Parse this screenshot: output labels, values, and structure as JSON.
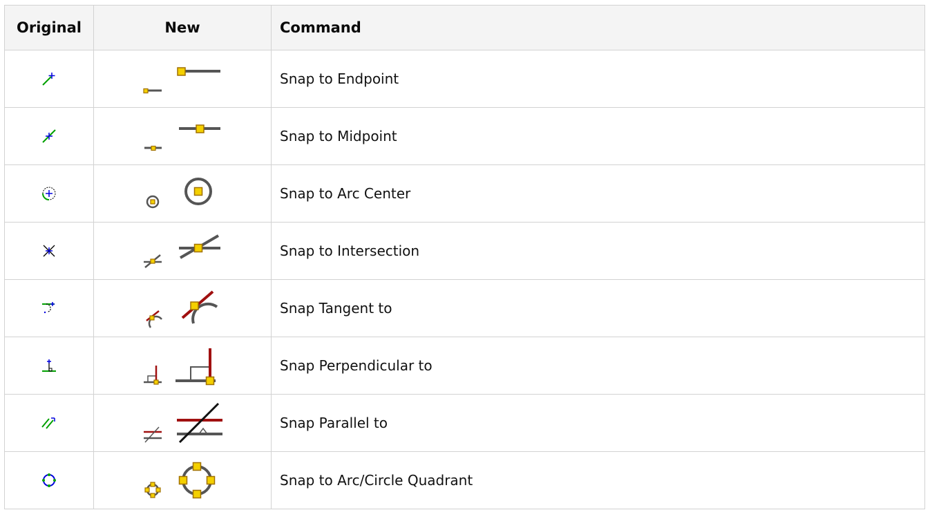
{
  "header": {
    "original": "Original",
    "new": "New",
    "command": "Command"
  },
  "rows": [
    {
      "command": "Snap to Endpoint",
      "icon": "snap-endpoint"
    },
    {
      "command": "Snap to Midpoint",
      "icon": "snap-midpoint"
    },
    {
      "command": "Snap to Arc Center",
      "icon": "snap-arc-center"
    },
    {
      "command": "Snap to Intersection",
      "icon": "snap-intersection"
    },
    {
      "command": "Snap Tangent to",
      "icon": "snap-tangent"
    },
    {
      "command": "Snap Perpendicular to",
      "icon": "snap-perpendicular"
    },
    {
      "command": "Snap Parallel to",
      "icon": "snap-parallel"
    },
    {
      "command": "Snap to Arc/Circle Quadrant",
      "icon": "snap-quadrant"
    }
  ],
  "colors": {
    "line_gray": "#555555",
    "snap_fill": "#f4d000",
    "snap_stroke": "#a07000",
    "red": "#a01010",
    "old_green": "#00a000",
    "old_blue": "#0000dd",
    "header_bg": "#f4f4f4",
    "border": "#d2d2d2"
  }
}
